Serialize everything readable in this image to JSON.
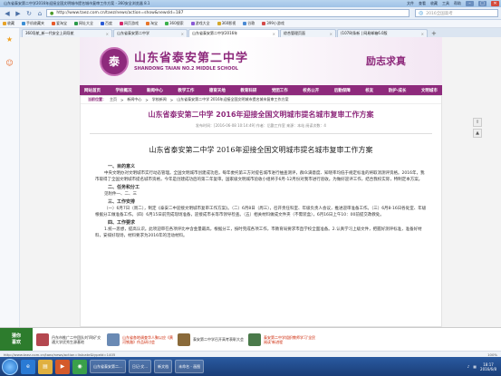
{
  "window": {
    "title": "山东省泰安第二中学2016年迎接全国文明城市提名城市复审工作方案 - 360安全浏览器 8.1",
    "menu_right": [
      "文件",
      "查看",
      "收藏",
      "工具",
      "帮助"
    ]
  },
  "navbar": {
    "url": "http://www.taez.com.cn/taez/news/action=show&newsId=187",
    "search_placeholder": "2016全国高考"
  },
  "bookmarks": [
    {
      "label": "收藏",
      "color": "#e8a326"
    },
    {
      "label": "手机收藏夹",
      "color": "#3b8ed4"
    },
    {
      "label": "爱淘宝",
      "color": "#e85a2a"
    },
    {
      "label": "网址大全",
      "color": "#2a9a4a"
    },
    {
      "label": "百度",
      "color": "#2a5ad4"
    },
    {
      "label": "网页游戏",
      "color": "#d42a6a"
    },
    {
      "label": "淘宝",
      "color": "#e8762a"
    },
    {
      "label": "360搜索",
      "color": "#3ab04a"
    },
    {
      "label": "游戏大全",
      "color": "#8a5ad4"
    },
    {
      "label": "360影视",
      "color": "#d4a82a"
    },
    {
      "label": "谷歌",
      "color": "#4a8ad4"
    },
    {
      "label": "399小游戏",
      "color": "#d44a4a"
    }
  ],
  "tabs": [
    {
      "label": "360导航_新一代安全上网导航",
      "active": false
    },
    {
      "label": "山东省泰安第二中学",
      "active": false
    },
    {
      "label": "山东省泰安第二中学2016年",
      "active": true
    },
    {
      "label": "综合管理页面",
      "active": false
    },
    {
      "label": "(1078)条新 | 网易邮箱6.0版",
      "active": false
    }
  ],
  "site": {
    "school_cn": "山东省泰安第二中学",
    "school_en": "SHANDONG TAIAN NO.2 MIDDLE SCHOOL",
    "motto": "励志求真",
    "menu": [
      "网站首页",
      "学校概况",
      "新闻中心",
      "教学工作",
      "德育天地",
      "教育科研",
      "党团工作",
      "校务公开",
      "后勤保障",
      "校友",
      "防护·成长",
      "文明城市"
    ]
  },
  "article": {
    "crumb_label": "当前位置：",
    "crumb_path": [
      "主页",
      "新闻中心",
      "学校新闻",
      "山东省泰安第二中学 2016年迎接全国文明城市提名城市复审工作方案"
    ],
    "title": "山东省泰安第二中学 2016年迎接全国文明城市提名城市复审工作方案",
    "meta": "发布时间：[2016-06-08 10:14:49]  作者：后勤工作室  来源：本站  阅读次数：4",
    "subtitle": "山东省泰安第二中学 2016年迎接全国文明城市提名城市复审工作方案",
    "sections": [
      {
        "heading": "一、目的意义",
        "text": "中央文明办对文明城市实行动态管理。全国文明城市创建成功后，每年委托第三方对提名城市进行抽查测评，群众满意度、知晓率均低于规定标准的将取消测评资格。2016年，我市取得了全国文明城市提名城市资格，今年是创建成功后的第二年复审。国家级文明城市验收小组将于6月-12月份对我市进行验收。为做好迎评工作，结合我校实际，特制定本方案。"
      },
      {
        "heading": "二、任务和分工",
        "text": "见附件一、二、三"
      },
      {
        "heading": "三、工作安排",
        "text": "（一）6月7日（周二），制定《泰安二中迎接文明城市复审工作方案》。（二）6月8日（周三），召开责任科室、年级负责人会议，推进迎审准备工作。（三）6月8-16日各处室、年级根据分工做准备工作。（四）6月15日前完成现场准备，迎接成市长等市领导检查。（五）相关材料做成文件夹（不需装盒），6月16日上午10：00前提交政教处。"
      },
      {
        "heading": "四、工作要求",
        "text": "1.统一思想，提高认识。此项迎审在各项评比中含金量最高，根据分工，按时完成各项工作，市教育局要求市直学校全面准备。2.认真学习上级文件，把握好测评标准，准备好材料，安排好现场，材料要求为2016年的活动材料。"
      }
    ]
  },
  "news_strip": {
    "badge_line1": "猜你",
    "badge_line2": "喜欢",
    "items": [
      {
        "text": "丹东市推广二中团队刘'四好'交通大学优秀生源基地",
        "red": false,
        "thumb": "#b4474f"
      },
      {
        "text": "山东省各地调查华人聚以应《黄河铁路》作品研讨会",
        "red": true,
        "thumb": "#6a8ab4"
      },
      {
        "text": "泰安第二中学召开高考表彰大会",
        "red": false,
        "thumb": "#8a6a3a"
      },
      {
        "text": "泰安第二中学组织教师学习'全民阅读'新进程",
        "red": true,
        "thumb": "#4a7a4a"
      }
    ]
  },
  "statusbar": {
    "left": "http://www.taez.com.cn/taez/news/action=listcate&typeId=1405",
    "right": "100%"
  },
  "taskbar": {
    "tasks": [
      "山东省泰安第二...",
      "日记-文...",
      "新文档",
      "未命名 - 画图"
    ],
    "time": "18:17",
    "date": "2016/6/8"
  }
}
